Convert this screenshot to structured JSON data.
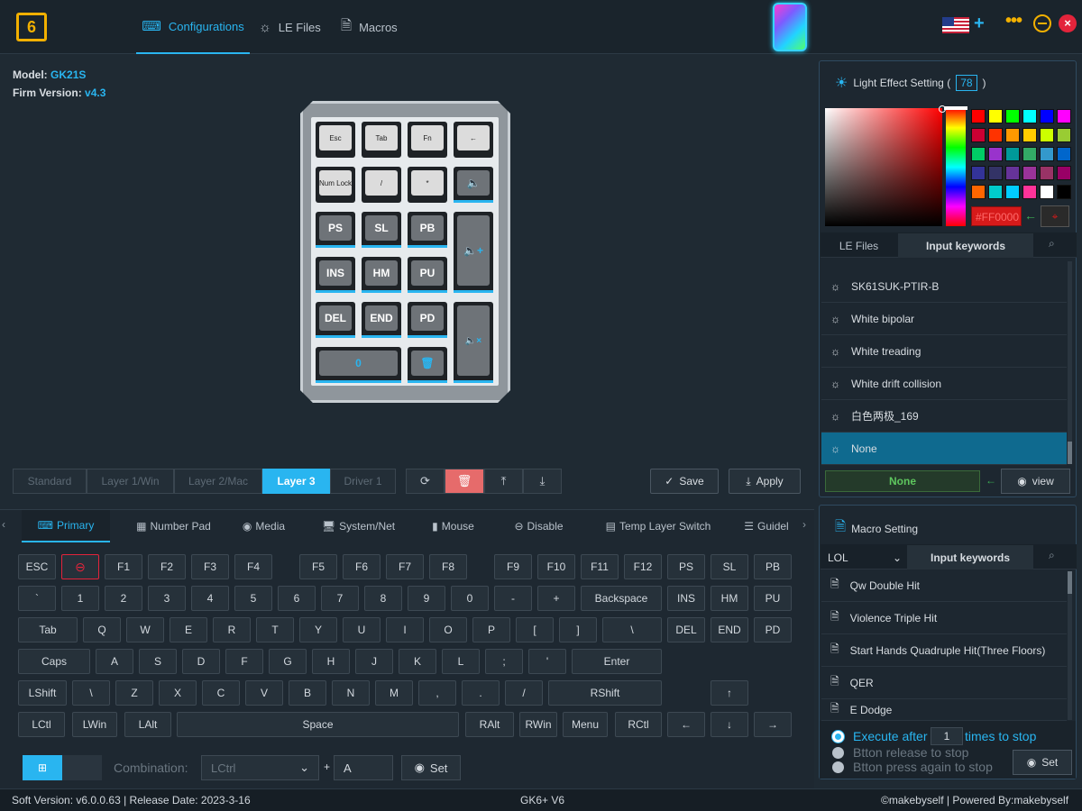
{
  "app": {
    "logo_text": "6"
  },
  "nav": {
    "configurations": "Configurations",
    "le_files": "LE Files",
    "macros": "Macros"
  },
  "info": {
    "model_label": "Model:",
    "model_value": "GK21S",
    "firm_label": "Firm Version:",
    "firm_value": "v4.3"
  },
  "device_keys": [
    {
      "label": "Esc"
    },
    {
      "label": "Tab"
    },
    {
      "label": "Fn"
    },
    {
      "label": "←"
    },
    {
      "label": "Num Lock"
    },
    {
      "label": "/"
    },
    {
      "label": "*"
    },
    {
      "label": "🔈"
    },
    {
      "label": "PS"
    },
    {
      "label": "SL"
    },
    {
      "label": "PB"
    },
    {
      "label": "🔈+"
    },
    {
      "label": "INS"
    },
    {
      "label": "HM"
    },
    {
      "label": "PU"
    },
    {
      "label": "DEL"
    },
    {
      "label": "END"
    },
    {
      "label": "PD"
    },
    {
      "label": "🔈×"
    },
    {
      "label": "0"
    },
    {
      "label": "🗑"
    }
  ],
  "layers": {
    "standard": "Standard",
    "layer1": "Layer 1/Win",
    "layer2": "Layer 2/Mac",
    "layer3": "Layer 3",
    "driver1": "Driver 1"
  },
  "actions": {
    "save": "Save",
    "apply": "Apply"
  },
  "key_tabs": [
    "Primary",
    "Number Pad",
    "Media",
    "System/Net",
    "Mouse",
    "Disable",
    "Temp Layer Switch",
    "Guidel"
  ],
  "keyboard": {
    "row1": [
      "ESC",
      "F1",
      "F2",
      "F3",
      "F4",
      "F5",
      "F6",
      "F7",
      "F8",
      "F9",
      "F10",
      "F11",
      "F12",
      "PS",
      "SL",
      "PB"
    ],
    "row2": [
      "`",
      "1",
      "2",
      "3",
      "4",
      "5",
      "6",
      "7",
      "8",
      "9",
      "0",
      "-",
      "+",
      "Backspace",
      "INS",
      "HM",
      "PU"
    ],
    "row3": [
      "Tab",
      "Q",
      "W",
      "E",
      "R",
      "T",
      "Y",
      "U",
      "I",
      "O",
      "P",
      "[",
      "]",
      "\\",
      "DEL",
      "END",
      "PD"
    ],
    "row4": [
      "Caps",
      "A",
      "S",
      "D",
      "F",
      "G",
      "H",
      "J",
      "K",
      "L",
      ";",
      "'",
      "Enter"
    ],
    "row5": [
      "LShift",
      "\\",
      "Z",
      "X",
      "C",
      "V",
      "B",
      "N",
      "M",
      ",",
      ".",
      "/",
      "RShift",
      "↑"
    ],
    "row6": [
      "LCtl",
      "LWin",
      "LAlt",
      "Space",
      "RAlt",
      "RWin",
      "Menu",
      "RCtl",
      "←",
      "↓",
      "→"
    ]
  },
  "combination": {
    "label": "Combination:",
    "modifier": "LCtrl",
    "plus": "+",
    "key": "A",
    "set": "Set"
  },
  "status": {
    "left": "Soft Version: v6.0.0.63 | Release Date: 2023-3-16",
    "center": "GK6+ V6",
    "right": "©makebyself | Powered By:makebyself"
  },
  "light_effect": {
    "title": "Light Effect Setting (",
    "value": "78",
    "close_paren": ")",
    "hex": "#FF0000",
    "swatches": [
      "#ff0000",
      "#ffff00",
      "#00ff00",
      "#00ffff",
      "#0000ff",
      "#ff00ff",
      "#cc0033",
      "#ff3300",
      "#ff9900",
      "#ffcc00",
      "#ccff00",
      "#99cc33",
      "#00cc66",
      "#9933cc",
      "#009999",
      "#33aa66",
      "#3399cc",
      "#0066cc",
      "#333399",
      "#333366",
      "#663399",
      "#993399",
      "#993366",
      "#990066",
      "#ff6600",
      "#00cccc",
      "#00ccff",
      "#ff3399",
      "#ffffff",
      "#000000"
    ],
    "tab_files": "LE Files",
    "tab_keywords": "Input keywords",
    "items": [
      "SK61SUK-PTIR-B",
      "White bipolar",
      "White treading",
      "White drift collision",
      "白色两极_169",
      "None"
    ],
    "selected": "None",
    "view": "view"
  },
  "macro": {
    "title": "Macro Setting",
    "dropdown": "LOL",
    "keywords": "Input keywords",
    "items": [
      "Qw Double Hit",
      "Violence Triple Hit",
      "Start Hands Quadruple Hit(Three Floors)",
      "QER",
      "E Dodge"
    ],
    "exec_prefix": "Execute after",
    "exec_count": "1",
    "exec_suffix": "times to stop",
    "opt_release": "Btton release to stop",
    "opt_press": "Btton press again to stop",
    "set": "Set"
  }
}
